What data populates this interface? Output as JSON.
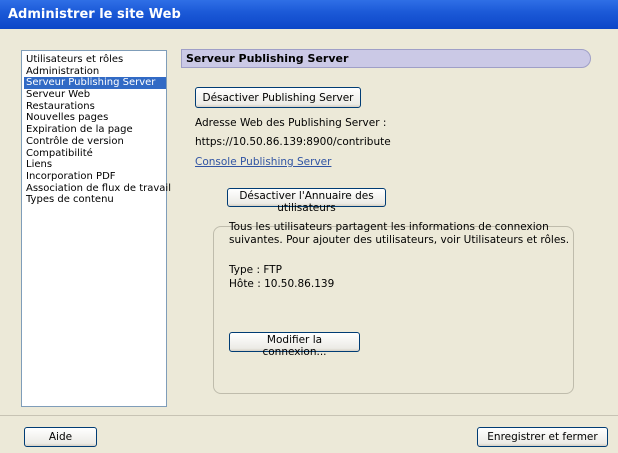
{
  "window": {
    "title": "Administrer le site Web"
  },
  "sidebar": {
    "items": [
      {
        "label": "Utilisateurs et rôles"
      },
      {
        "label": "Administration"
      },
      {
        "label": "Serveur Publishing Server",
        "selected": true
      },
      {
        "label": "Serveur Web"
      },
      {
        "label": "Restaurations"
      },
      {
        "label": "Nouvelles pages"
      },
      {
        "label": "Expiration de la page"
      },
      {
        "label": "Contrôle de version"
      },
      {
        "label": "Compatibilité"
      },
      {
        "label": "Liens"
      },
      {
        "label": "Incorporation PDF"
      },
      {
        "label": "Association de flux de travail"
      },
      {
        "label": "Types de contenu"
      }
    ]
  },
  "main": {
    "header": "Serveur Publishing Server",
    "disable_publishing_label": "Désactiver Publishing Server",
    "address_label": "Adresse Web des Publishing Server :",
    "address_value": "https://10.50.86.139:8900/contribute",
    "console_link": "Console Publishing Server",
    "group": {
      "disable_directory_label": "Désactiver l'Annuaire des utilisateurs",
      "info_line1": "Tous les utilisateurs partagent les informations de connexion",
      "info_line2": "suivantes. Pour ajouter des utilisateurs, voir Utilisateurs et rôles.",
      "type_line": "Type : FTP",
      "host_line": "Hôte : 10.50.86.139",
      "modify_label": "Modifier la connexion..."
    }
  },
  "footer": {
    "help_label": "Aide",
    "save_close_label": "Enregistrer et fermer"
  },
  "colors": {
    "selection": "#316ac5",
    "titlebar": "#0c46c8",
    "header_pill": "#cbc9e6",
    "link": "#3054a3"
  }
}
